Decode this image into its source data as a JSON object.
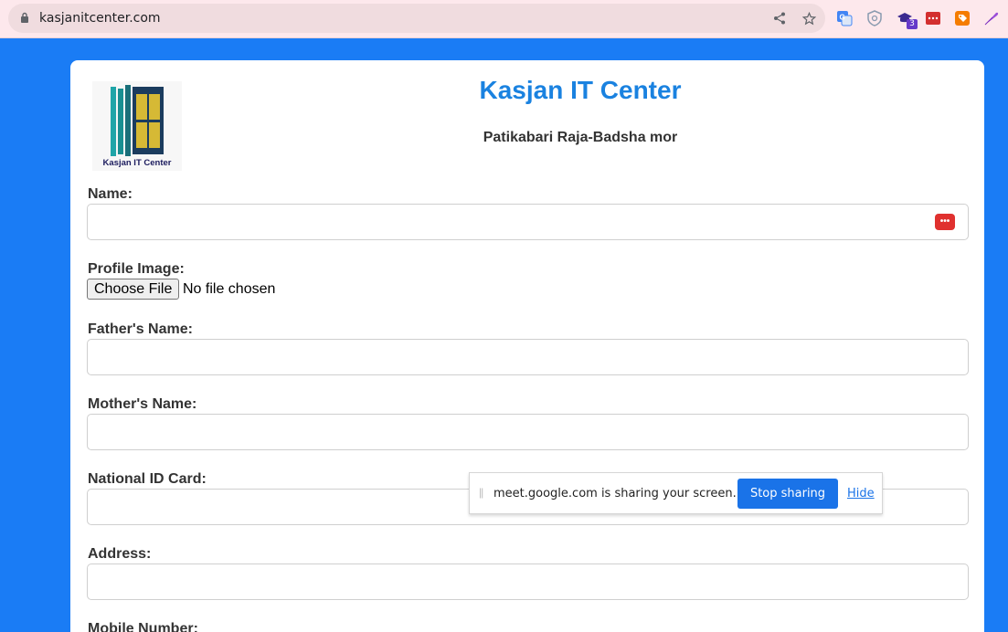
{
  "browser": {
    "url": "kasjanitcenter.com",
    "extension_badge": "3"
  },
  "site": {
    "title": "Kasjan IT Center",
    "subtitle": "Patikabari Raja-Badsha mor",
    "logo_text": "Kasjan IT Center"
  },
  "form": {
    "name_label": "Name:",
    "name_value": "",
    "profile_image_label": "Profile Image:",
    "choose_file_label": "Choose File",
    "no_file_text": "No file chosen",
    "father_label": "Father's Name:",
    "mother_label": "Mother's Name:",
    "nid_label": "National ID Card:",
    "address_label": "Address:",
    "mobile_label": "Mobile Number:"
  },
  "share_bar": {
    "message": "meet.google.com is sharing your screen.",
    "stop_label": "Stop sharing",
    "hide_label": "Hide"
  },
  "icons": [
    "lock-icon",
    "share-icon",
    "star-icon",
    "translate-extension-icon",
    "shield-extension-icon",
    "cap-extension-icon",
    "password-manager-icon",
    "tag-extension-icon",
    "feather-extension-icon"
  ]
}
